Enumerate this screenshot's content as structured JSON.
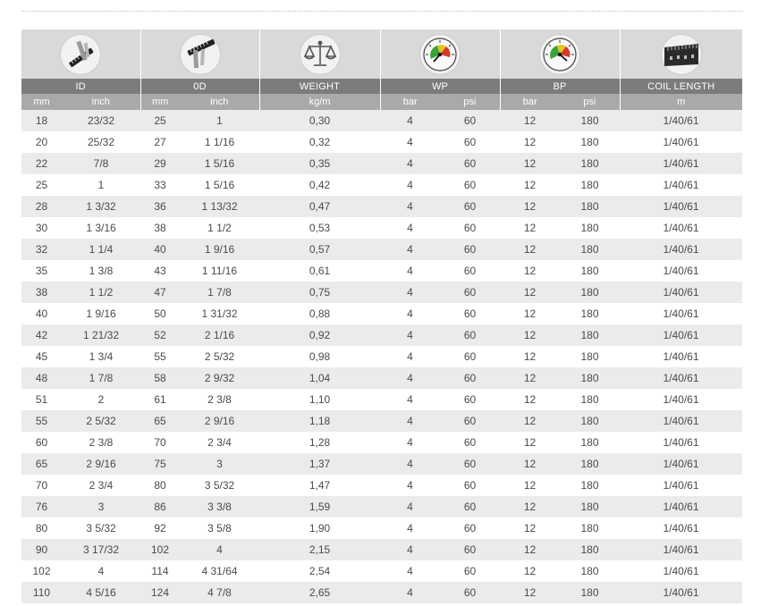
{
  "columns": {
    "id": "ID",
    "od": "0D",
    "weight": "WEIGHT",
    "wp": "WP",
    "bp": "BP",
    "coil": "COIL LENGTH"
  },
  "units": {
    "id_mm": "mm",
    "id_inch": "inch",
    "od_mm": "mm",
    "od_inch": "inch",
    "weight": "kg/m",
    "wp_bar": "bar",
    "wp_psi": "psi",
    "bp_bar": "bar",
    "bp_psi": "psi",
    "coil": "m"
  },
  "icons": {
    "id": "caliper-icon",
    "od": "caliper-icon",
    "weight": "scale-icon",
    "wp": "pressure-gauge-icon",
    "bp": "pressure-gauge-icon",
    "coil": "tape-measure-icon"
  },
  "colors": {
    "header_dark": "#7c7c7c",
    "header_light": "#a9a9a9",
    "icon_band": "#d9d9d9",
    "row_stripe": "#ebebeb",
    "text": "#4a4a4a"
  },
  "rows": [
    [
      "18",
      "23/32",
      "25",
      "1",
      "0,30",
      "4",
      "60",
      "12",
      "180",
      "1/40/61"
    ],
    [
      "20",
      "25/32",
      "27",
      "1 1/16",
      "0,32",
      "4",
      "60",
      "12",
      "180",
      "1/40/61"
    ],
    [
      "22",
      "7/8",
      "29",
      "1 5/16",
      "0,35",
      "4",
      "60",
      "12",
      "180",
      "1/40/61"
    ],
    [
      "25",
      "1",
      "33",
      "1 5/16",
      "0,42",
      "4",
      "60",
      "12",
      "180",
      "1/40/61"
    ],
    [
      "28",
      "1 3/32",
      "36",
      "1 13/32",
      "0,47",
      "4",
      "60",
      "12",
      "180",
      "1/40/61"
    ],
    [
      "30",
      "1 3/16",
      "38",
      "1 1/2",
      "0,53",
      "4",
      "60",
      "12",
      "180",
      "1/40/61"
    ],
    [
      "32",
      "1 1/4",
      "40",
      "1 9/16",
      "0,57",
      "4",
      "60",
      "12",
      "180",
      "1/40/61"
    ],
    [
      "35",
      "1 3/8",
      "43",
      "1 11/16",
      "0,61",
      "4",
      "60",
      "12",
      "180",
      "1/40/61"
    ],
    [
      "38",
      "1 1/2",
      "47",
      "1 7/8",
      "0,75",
      "4",
      "60",
      "12",
      "180",
      "1/40/61"
    ],
    [
      "40",
      "1 9/16",
      "50",
      "1 31/32",
      "0,88",
      "4",
      "60",
      "12",
      "180",
      "1/40/61"
    ],
    [
      "42",
      "1 21/32",
      "52",
      "2 1/16",
      "0,92",
      "4",
      "60",
      "12",
      "180",
      "1/40/61"
    ],
    [
      "45",
      "1 3/4",
      "55",
      "2 5/32",
      "0,98",
      "4",
      "60",
      "12",
      "180",
      "1/40/61"
    ],
    [
      "48",
      "1 7/8",
      "58",
      "2 9/32",
      "1,04",
      "4",
      "60",
      "12",
      "180",
      "1/40/61"
    ],
    [
      "51",
      "2",
      "61",
      "2 3/8",
      "1,10",
      "4",
      "60",
      "12",
      "180",
      "1/40/61"
    ],
    [
      "55",
      "2 5/32",
      "65",
      "2 9/16",
      "1,18",
      "4",
      "60",
      "12",
      "180",
      "1/40/61"
    ],
    [
      "60",
      "2 3/8",
      "70",
      "2 3/4",
      "1,28",
      "4",
      "60",
      "12",
      "180",
      "1/40/61"
    ],
    [
      "65",
      "2 9/16",
      "75",
      "3",
      "1,37",
      "4",
      "60",
      "12",
      "180",
      "1/40/61"
    ],
    [
      "70",
      "2 3/4",
      "80",
      "3 5/32",
      "1,47",
      "4",
      "60",
      "12",
      "180",
      "1/40/61"
    ],
    [
      "76",
      "3",
      "86",
      "3 3/8",
      "1,59",
      "4",
      "60",
      "12",
      "180",
      "1/40/61"
    ],
    [
      "80",
      "3 5/32",
      "92",
      "3 5/8",
      "1,90",
      "4",
      "60",
      "12",
      "180",
      "1/40/61"
    ],
    [
      "90",
      "3 17/32",
      "102",
      "4",
      "2,15",
      "4",
      "60",
      "12",
      "180",
      "1/40/61"
    ],
    [
      "102",
      "4",
      "114",
      "4 31/64",
      "2,54",
      "4",
      "60",
      "12",
      "180",
      "1/40/61"
    ],
    [
      "110",
      "4 5/16",
      "124",
      "4 7/8",
      "2,65",
      "4",
      "60",
      "12",
      "180",
      "1/40/61"
    ]
  ]
}
